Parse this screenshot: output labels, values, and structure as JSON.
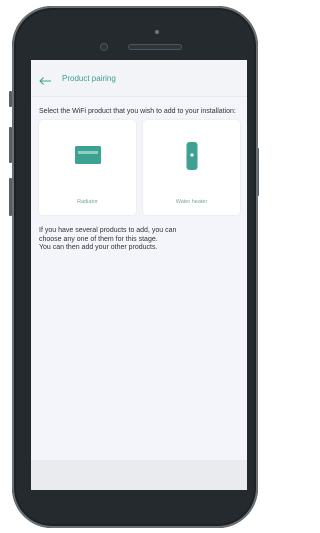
{
  "app": {
    "title": "Product pairing",
    "back_icon": "arrow-left-icon"
  },
  "instruction": "Select the WiFi product that you wish to add to your installation:",
  "products": [
    {
      "label": "Radiator",
      "icon": "radiator-icon"
    },
    {
      "label": "Water heater",
      "icon": "water-heater-icon"
    }
  ],
  "info": {
    "line1": "If you have several products to add, you can",
    "line2": "choose any one of them for this stage.",
    "line3": "You can then add your other products."
  },
  "colors": {
    "accent": "#3c9f8e",
    "screen_bg": "#f3f5fa",
    "phone_body": "#242a2e"
  }
}
